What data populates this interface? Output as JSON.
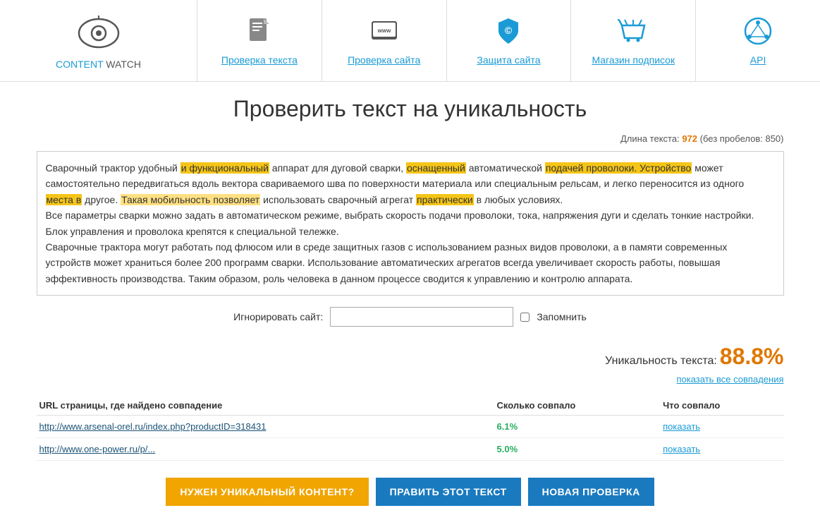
{
  "header": {
    "logo": {
      "content_text": "CONTENT",
      "watch_text": " WATCH"
    },
    "nav": [
      {
        "id": "check-text",
        "label": "Проверка текста",
        "icon": "document-icon"
      },
      {
        "id": "check-site",
        "label": "Проверка сайта",
        "icon": "www-icon"
      },
      {
        "id": "protect-site",
        "label": "Защита сайта",
        "icon": "shield-icon"
      },
      {
        "id": "shop",
        "label": "Магазин подписок",
        "icon": "basket-icon"
      },
      {
        "id": "api",
        "label": "API",
        "icon": "api-icon"
      }
    ]
  },
  "main": {
    "title": "Проверить текст на уникальность",
    "text_length_label": "Длина текста:",
    "text_length_count": "972",
    "text_length_suffix": "(без пробелов: 850)",
    "ignore_label": "Игнорировать сайт:",
    "ignore_placeholder": "",
    "remember_label": "Запомнить",
    "uniqueness_label": "Уникальность текста:",
    "uniqueness_value": "88.8%",
    "show_all_label": "показать все совпадения",
    "table": {
      "columns": [
        "URL страницы, где найдено совпадение",
        "Сколько совпало",
        "Что совпало"
      ],
      "rows": [
        {
          "url": "http://www.arsenal-orel.ru/index.php?productID=318431",
          "percent": "6.1%",
          "action": "показать"
        },
        {
          "url": "http://www.one-power.ru/p/...",
          "percent": "5.0%",
          "action": "показать"
        }
      ]
    },
    "buttons": [
      {
        "id": "need-unique",
        "label": "НУЖЕН УНИКАЛЬНЫЙ КОНТЕНТ?",
        "style": "orange"
      },
      {
        "id": "edit-text",
        "label": "ПРАВИТЬ ЭТОТ ТЕКСТ",
        "style": "blue"
      },
      {
        "id": "new-check",
        "label": "НОВАЯ ПРОВЕРКА",
        "style": "blue"
      }
    ]
  }
}
